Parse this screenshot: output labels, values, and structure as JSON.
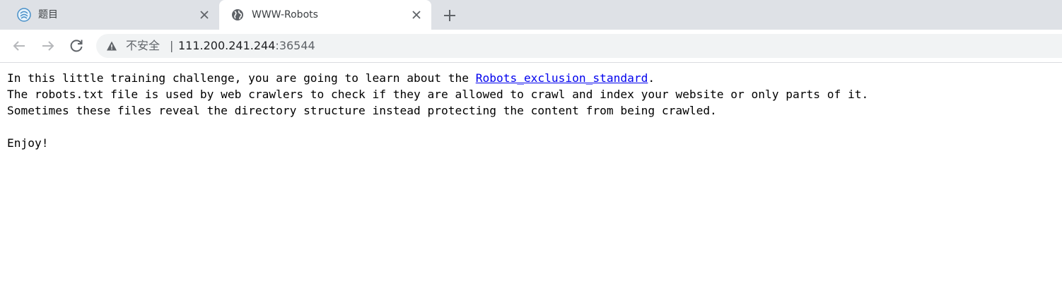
{
  "tabs": [
    {
      "title": "题目",
      "favicon": "ctf-platform-logo-icon",
      "active": false
    },
    {
      "title": "WWW-Robots",
      "favicon": "globe-icon",
      "active": true
    }
  ],
  "toolbar": {
    "back_icon": "back-arrow-icon",
    "forward_icon": "forward-arrow-icon",
    "reload_icon": "reload-icon"
  },
  "address_bar": {
    "security_label": "不安全",
    "separator": "|",
    "host": "111.200.241.244",
    "port": ":36544"
  },
  "page": {
    "line1_before": "In this little training challenge, you are going to learn about the ",
    "link_text": "Robots_exclusion_standard",
    "line1_after": ".",
    "line2": "The robots.txt file is used by web crawlers to check if they are allowed to crawl and index your website or only parts of it.",
    "line3": "Sometimes these files reveal the directory structure instead protecting the content from being crawled.",
    "line4": "Enjoy!"
  },
  "colors": {
    "tabstrip": "#dee1e6",
    "link": "#0000ee",
    "omnibox": "#f1f3f4"
  }
}
